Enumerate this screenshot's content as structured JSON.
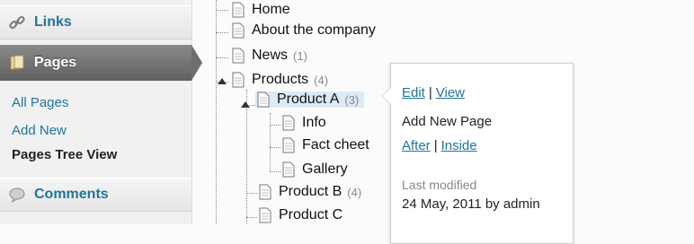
{
  "sidebar": {
    "links_label": "Links",
    "pages_label": "Pages",
    "submenu": {
      "all_pages": "All Pages",
      "add_new": "Add New",
      "tree_view": "Pages Tree View"
    },
    "comments_label": "Comments"
  },
  "tree": {
    "home": "Home",
    "about": "About the company",
    "news": {
      "title": "News",
      "count": "(1)"
    },
    "products": {
      "title": "Products",
      "count": "(4)"
    },
    "product_a": {
      "title": "Product A",
      "count": "(3)"
    },
    "info": "Info",
    "fact": "Fact cheet",
    "gallery": "Gallery",
    "product_b": {
      "title": "Product B",
      "count": "(4)"
    },
    "product_c": "Product C"
  },
  "popup": {
    "edit": "Edit",
    "sep": "|",
    "view": "View",
    "add_new_page": "Add New Page",
    "after": "After",
    "inside": "Inside",
    "last_modified_label": "Last modified",
    "last_modified_value": "24 May, 2011 by admin"
  },
  "colors": {
    "link": "#21759b",
    "highlight": "#dde9f5",
    "active_menu": "#6e6e6e"
  }
}
